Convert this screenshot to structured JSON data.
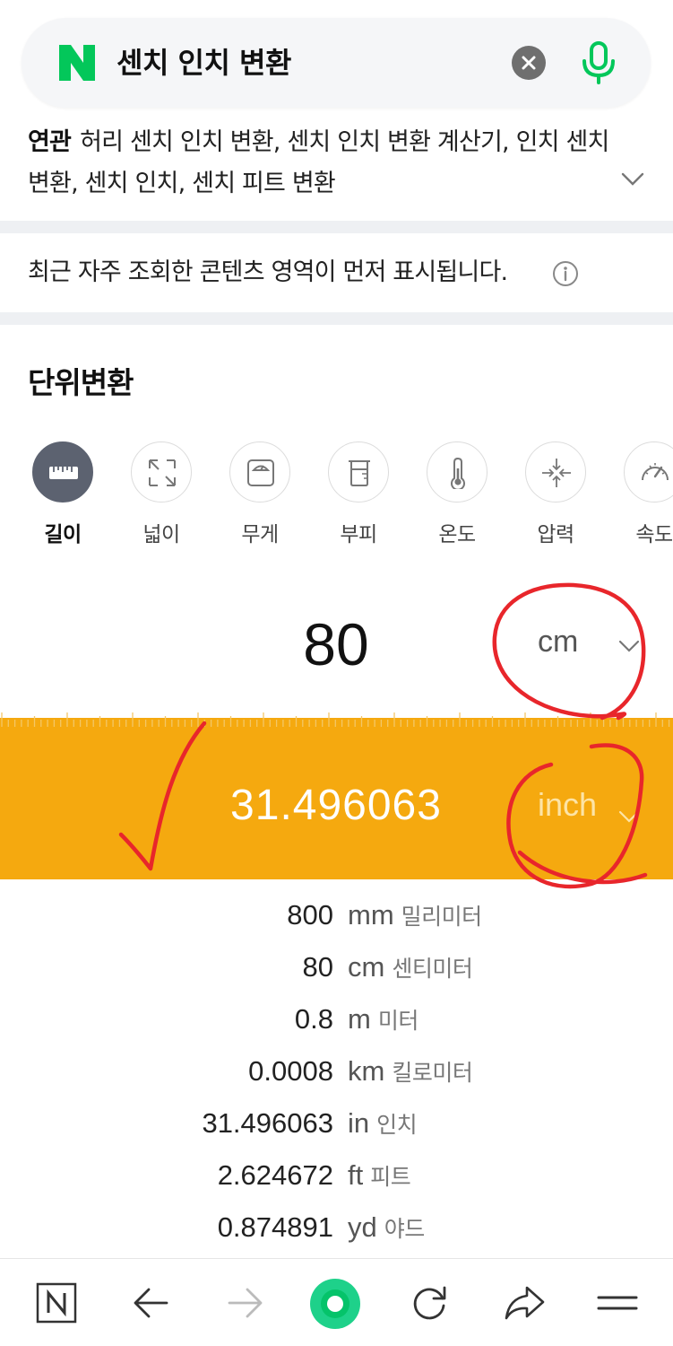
{
  "search": {
    "query": "센치 인치 변환"
  },
  "related": {
    "label": "연관",
    "text": "허리 센치 인치 변환, 센치 인치 변환 계산기, 인치 센치 변환, 센치 인치, 센치 피트 변환"
  },
  "notice": {
    "text": "최근 자주 조회한 콘텐츠 영역이 먼저 표시됩니다."
  },
  "converter": {
    "title": "단위변환",
    "categories": [
      {
        "label": "길이",
        "icon": "ruler-icon",
        "active": true
      },
      {
        "label": "넓이",
        "icon": "expand-arrows-icon",
        "active": false
      },
      {
        "label": "무게",
        "icon": "scale-icon",
        "active": false
      },
      {
        "label": "부피",
        "icon": "beaker-icon",
        "active": false
      },
      {
        "label": "온도",
        "icon": "thermometer-icon",
        "active": false
      },
      {
        "label": "압력",
        "icon": "pressure-icon",
        "active": false
      },
      {
        "label": "속도",
        "icon": "speedometer-icon",
        "active": false
      }
    ],
    "input": {
      "value": "80",
      "unit": "cm"
    },
    "output": {
      "value": "31.496063",
      "unit": "inch"
    },
    "results": [
      {
        "value": "800",
        "unit": "mm",
        "name": "밀리미터"
      },
      {
        "value": "80",
        "unit": "cm",
        "name": "센티미터"
      },
      {
        "value": "0.8",
        "unit": "m",
        "name": "미터"
      },
      {
        "value": "0.0008",
        "unit": "km",
        "name": "킬로미터"
      },
      {
        "value": "31.496063",
        "unit": "in",
        "name": "인치"
      },
      {
        "value": "2.624672",
        "unit": "ft",
        "name": "피트"
      },
      {
        "value": "0.874891",
        "unit": "yd",
        "name": "야드"
      }
    ]
  },
  "colors": {
    "accent_orange": "#f5a90f",
    "naver_green": "#03c75a",
    "annotation_red": "#e8262b"
  }
}
